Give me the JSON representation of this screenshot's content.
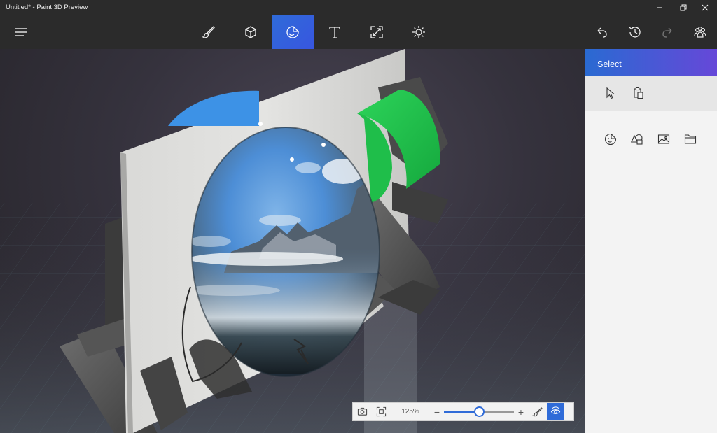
{
  "window": {
    "title": "Untitled* - Paint 3D Preview"
  },
  "toolbar": {
    "left": [
      {
        "icon": "menu-icon"
      }
    ],
    "tools": [
      {
        "icon": "brush-icon",
        "name": "Art tools"
      },
      {
        "icon": "cube-icon",
        "name": "3D objects"
      },
      {
        "icon": "sticker-icon",
        "name": "Stickers",
        "active": true
      },
      {
        "icon": "text-icon",
        "name": "Text"
      },
      {
        "icon": "canvas-icon",
        "name": "Canvas"
      },
      {
        "icon": "effects-icon",
        "name": "Effects"
      }
    ],
    "right": [
      {
        "icon": "undo-icon"
      },
      {
        "icon": "history-icon"
      },
      {
        "icon": "redo-icon",
        "disabled": true
      },
      {
        "icon": "community-icon"
      }
    ]
  },
  "panel": {
    "title": "Select",
    "select_tools": [
      {
        "icon": "select-cursor-icon"
      },
      {
        "icon": "paste-icon"
      }
    ],
    "sticker_types": [
      {
        "icon": "sticker-face-icon"
      },
      {
        "icon": "shapes-icon"
      },
      {
        "icon": "image-texture-icon"
      },
      {
        "icon": "folder-icon"
      }
    ]
  },
  "zoom": {
    "percent_label": "125%",
    "minus_label": "−",
    "plus_label": "+",
    "level_fraction": 0.5
  },
  "colors": {
    "accent": "#2f6bd8",
    "panel_gradient_start": "#2a6ad2",
    "panel_gradient_end": "#6648d8",
    "toolbar_bg": "#2b2b2b"
  }
}
